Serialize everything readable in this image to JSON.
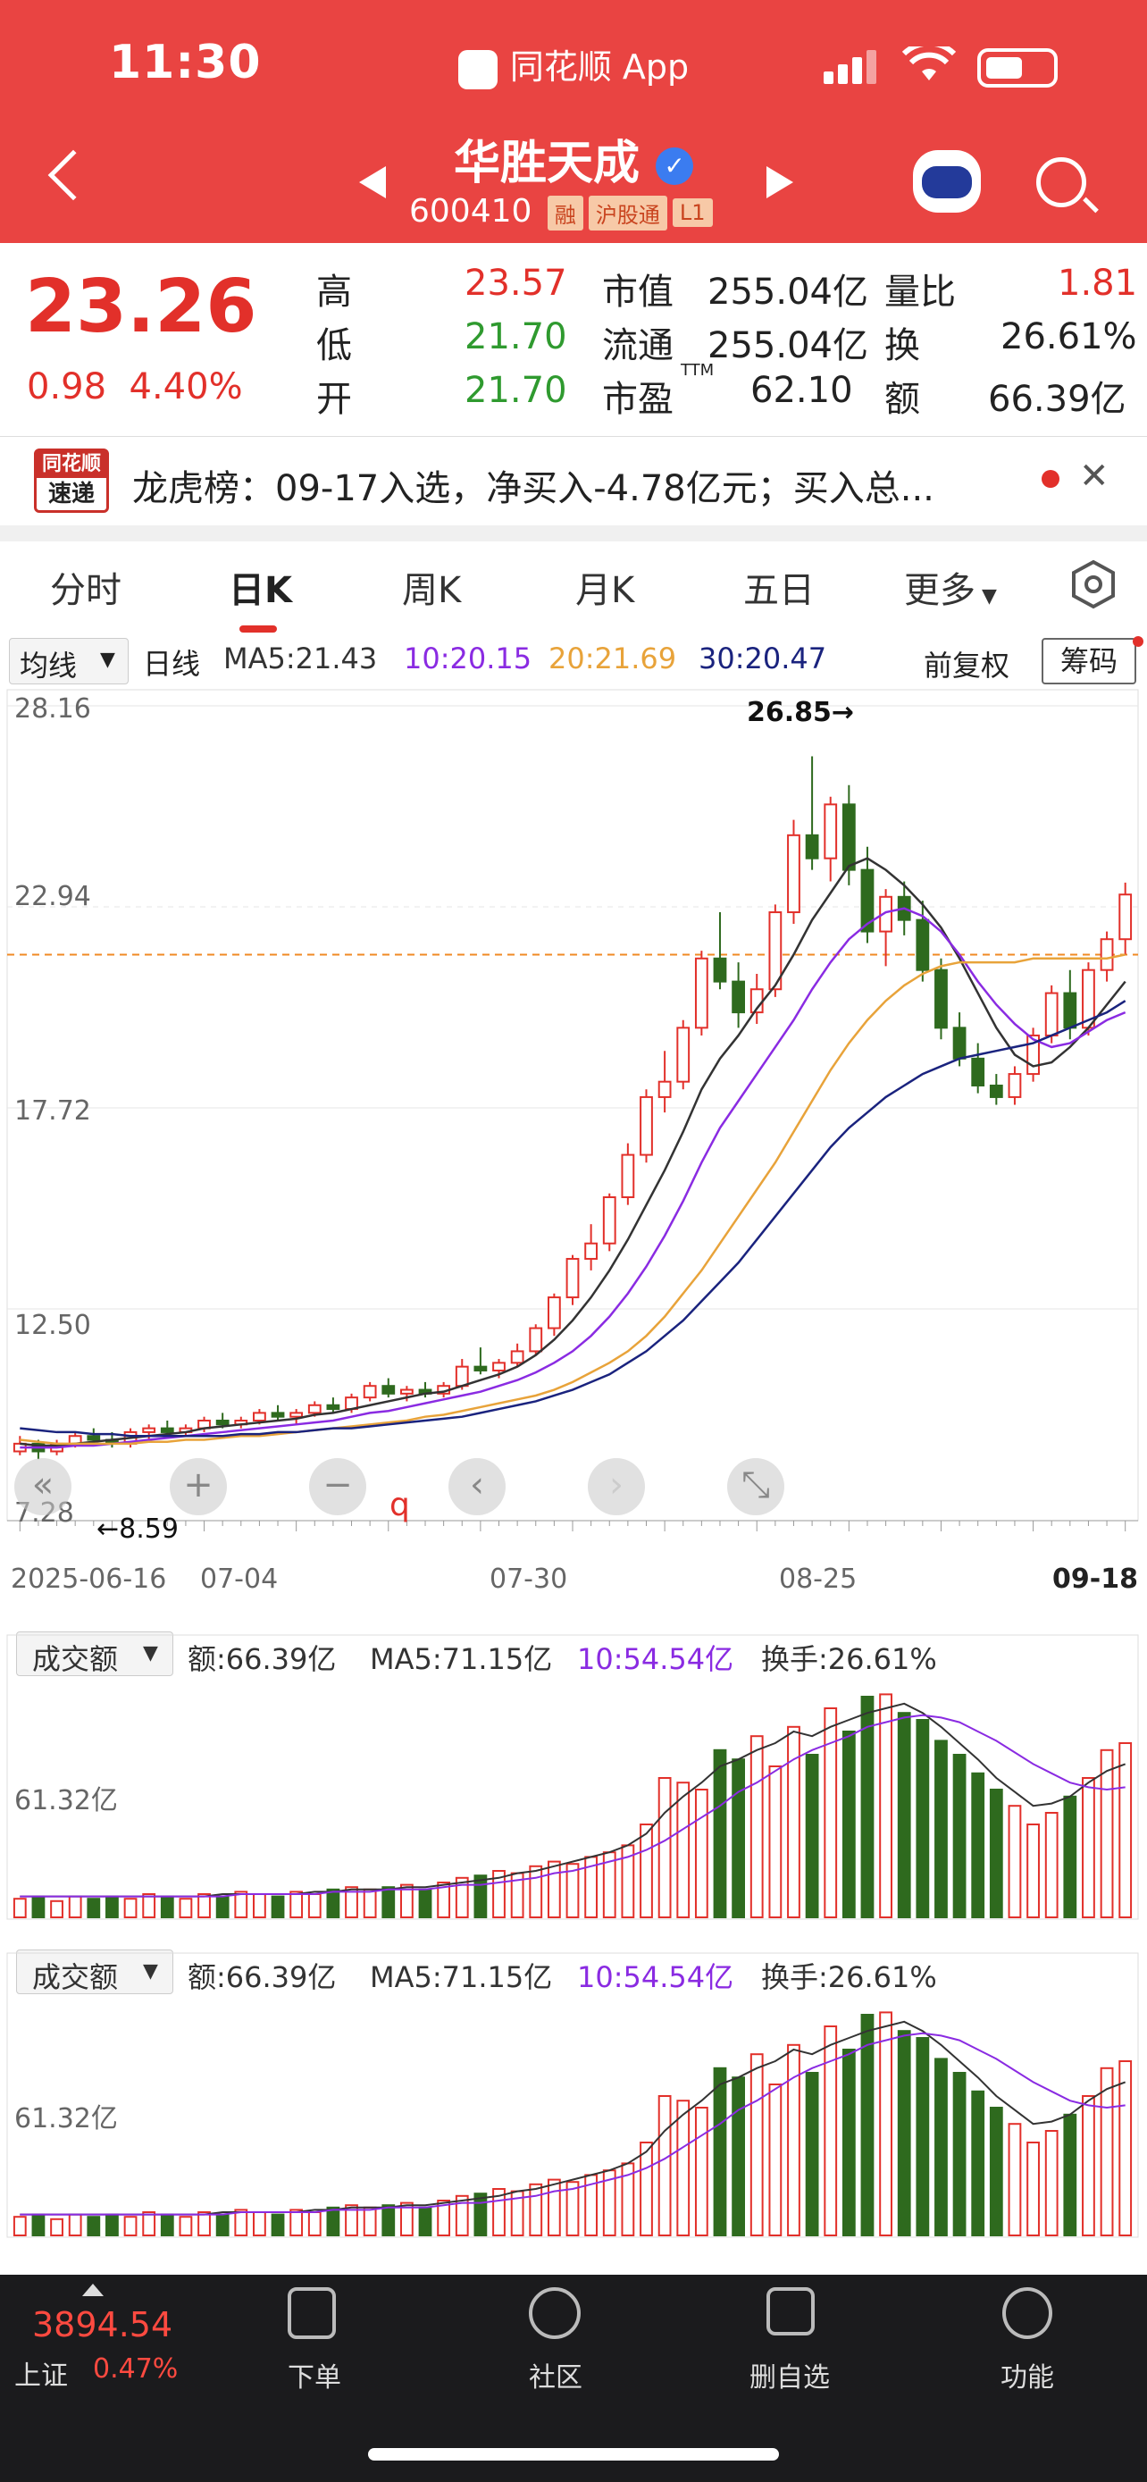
{
  "status_bar": {
    "time": "11:30",
    "app": "同花顺 App"
  },
  "header": {
    "stock_name": "华胜天成",
    "verified": "✓",
    "code": "600410",
    "tags": [
      "融",
      "沪股通",
      "L1"
    ]
  },
  "quote": {
    "price": "23.26",
    "change": "0.98",
    "change_pct": "4.40%",
    "fields": [
      {
        "label": "高",
        "value": "23.57"
      },
      {
        "label": "低",
        "value": "21.70"
      },
      {
        "label": "开",
        "value": "21.70"
      },
      {
        "label": "市值",
        "value": "255.04亿"
      },
      {
        "label": "流通",
        "value": "255.04亿"
      },
      {
        "label": "市盈",
        "sup": "TTM",
        "value": "62.10"
      },
      {
        "label": "量比",
        "value": "1.81"
      },
      {
        "label": "换",
        "value": "26.61%"
      },
      {
        "label": "额",
        "value": "66.39亿"
      }
    ]
  },
  "news": {
    "logo_top": "同花顺",
    "logo_bottom": "速递",
    "text": "龙虎榜：09-17入选，净买入-4.78亿元；买入总..."
  },
  "tabs": [
    "分时",
    "日K",
    "周K",
    "月K",
    "五日",
    "更多"
  ],
  "ma_row": {
    "selector": "均线",
    "period": "日线",
    "ma5": "MA5:21.43",
    "ma10": "10:20.15",
    "ma20": "20:21.69",
    "ma30": "30:20.47",
    "adjust": "前复权",
    "chips": "筹码"
  },
  "colors": {
    "up": "#e2302a",
    "down": "#2e6a1e",
    "ma5": "#333333",
    "ma10": "#8a2be2",
    "ma20": "#e8a33a",
    "ma30": "#1a237e",
    "header": "#e94442"
  },
  "chart_data": {
    "type": "candlestick",
    "y_ticks": [
      "28.16",
      "22.94",
      "17.72",
      "12.50",
      "7.28"
    ],
    "ylim": [
      7.28,
      28.16
    ],
    "x_ticks": [
      "2025-06-16",
      "07-04",
      "07-30",
      "08-25",
      "09-18"
    ],
    "annotations": {
      "high": "26.85→",
      "low": "←8.59",
      "marker": "q"
    },
    "current_price_line": 21.7,
    "candles": [
      [
        8.8,
        9.2,
        8.7,
        9.0
      ],
      [
        9.0,
        9.1,
        8.6,
        8.8
      ],
      [
        8.8,
        9.1,
        8.7,
        9.0
      ],
      [
        9.0,
        9.3,
        8.9,
        9.2
      ],
      [
        9.2,
        9.4,
        9.0,
        9.1
      ],
      [
        9.1,
        9.3,
        8.9,
        9.0
      ],
      [
        9.0,
        9.4,
        8.9,
        9.3
      ],
      [
        9.3,
        9.5,
        9.1,
        9.4
      ],
      [
        9.4,
        9.6,
        9.2,
        9.3
      ],
      [
        9.3,
        9.5,
        9.2,
        9.4
      ],
      [
        9.4,
        9.7,
        9.3,
        9.6
      ],
      [
        9.6,
        9.8,
        9.4,
        9.5
      ],
      [
        9.5,
        9.7,
        9.4,
        9.6
      ],
      [
        9.6,
        9.9,
        9.5,
        9.8
      ],
      [
        9.8,
        10.0,
        9.6,
        9.7
      ],
      [
        9.7,
        9.9,
        9.5,
        9.8
      ],
      [
        9.8,
        10.1,
        9.7,
        10.0
      ],
      [
        10.0,
        10.2,
        9.8,
        9.9
      ],
      [
        9.9,
        10.3,
        9.8,
        10.2
      ],
      [
        10.2,
        10.6,
        10.1,
        10.5
      ],
      [
        10.5,
        10.7,
        10.2,
        10.3
      ],
      [
        10.3,
        10.5,
        10.1,
        10.4
      ],
      [
        10.4,
        10.6,
        10.2,
        10.3
      ],
      [
        10.3,
        10.6,
        10.2,
        10.5
      ],
      [
        10.5,
        11.2,
        10.4,
        11.0
      ],
      [
        11.0,
        11.5,
        10.8,
        10.9
      ],
      [
        10.9,
        11.2,
        10.7,
        11.1
      ],
      [
        11.1,
        11.6,
        11.0,
        11.4
      ],
      [
        11.4,
        12.1,
        11.3,
        12.0
      ],
      [
        12.0,
        12.9,
        11.8,
        12.8
      ],
      [
        12.8,
        13.9,
        12.6,
        13.8
      ],
      [
        13.8,
        14.7,
        13.5,
        14.2
      ],
      [
        14.2,
        15.5,
        14.0,
        15.4
      ],
      [
        15.4,
        16.8,
        15.2,
        16.5
      ],
      [
        16.5,
        18.2,
        16.3,
        18.0
      ],
      [
        18.0,
        19.2,
        17.6,
        18.4
      ],
      [
        18.4,
        20.0,
        18.2,
        19.8
      ],
      [
        19.8,
        21.8,
        19.6,
        21.6
      ],
      [
        21.6,
        22.8,
        20.8,
        21.0
      ],
      [
        21.0,
        21.5,
        19.8,
        20.2
      ],
      [
        20.2,
        21.2,
        19.9,
        20.8
      ],
      [
        20.8,
        23.0,
        20.6,
        22.8
      ],
      [
        22.8,
        25.2,
        22.5,
        24.8
      ],
      [
        24.8,
        26.85,
        23.9,
        24.2
      ],
      [
        24.2,
        25.8,
        23.6,
        25.6
      ],
      [
        25.6,
        26.1,
        23.5,
        23.9
      ],
      [
        23.9,
        24.5,
        22.0,
        22.3
      ],
      [
        22.3,
        23.4,
        21.4,
        23.2
      ],
      [
        23.2,
        23.6,
        22.2,
        22.6
      ],
      [
        22.6,
        23.1,
        21.0,
        21.3
      ],
      [
        21.3,
        21.6,
        19.5,
        19.8
      ],
      [
        19.8,
        20.2,
        18.8,
        19.0
      ],
      [
        19.0,
        19.4,
        18.1,
        18.3
      ],
      [
        18.3,
        18.6,
        17.8,
        18.0
      ],
      [
        18.0,
        18.8,
        17.8,
        18.6
      ],
      [
        18.6,
        19.8,
        18.4,
        19.6
      ],
      [
        19.6,
        20.9,
        19.4,
        20.7
      ],
      [
        20.7,
        21.3,
        19.5,
        19.8
      ],
      [
        19.8,
        21.5,
        19.6,
        21.3
      ],
      [
        21.3,
        22.3,
        21.0,
        22.1
      ],
      [
        22.1,
        23.57,
        21.7,
        23.26
      ]
    ],
    "ma_lines": {
      "ma5": [
        9.0,
        8.95,
        8.95,
        9.0,
        9.05,
        9.1,
        9.15,
        9.2,
        9.25,
        9.3,
        9.4,
        9.45,
        9.5,
        9.55,
        9.6,
        9.65,
        9.75,
        9.8,
        9.9,
        10.0,
        10.1,
        10.2,
        10.3,
        10.35,
        10.5,
        10.65,
        10.8,
        11.0,
        11.3,
        11.7,
        12.2,
        12.8,
        13.5,
        14.3,
        15.2,
        16.1,
        17.1,
        18.2,
        19.0,
        19.6,
        20.3,
        20.9,
        21.7,
        22.6,
        23.3,
        24.0,
        24.2,
        23.9,
        23.5,
        23.0,
        22.4,
        21.6,
        20.7,
        19.8,
        19.1,
        18.8,
        18.9,
        19.3,
        19.8,
        20.4,
        21.0
      ],
      "ma10": [
        8.9,
        8.9,
        8.9,
        8.95,
        8.95,
        9.0,
        9.05,
        9.1,
        9.15,
        9.2,
        9.25,
        9.3,
        9.35,
        9.4,
        9.45,
        9.5,
        9.55,
        9.6,
        9.7,
        9.8,
        9.85,
        9.95,
        10.05,
        10.15,
        10.25,
        10.35,
        10.5,
        10.65,
        10.85,
        11.1,
        11.4,
        11.8,
        12.3,
        12.9,
        13.6,
        14.4,
        15.3,
        16.3,
        17.2,
        17.9,
        18.6,
        19.3,
        20.0,
        20.8,
        21.5,
        22.1,
        22.5,
        22.8,
        22.9,
        22.7,
        22.3,
        21.7,
        21.0,
        20.4,
        19.9,
        19.5,
        19.3,
        19.4,
        19.7,
        20.0,
        20.2
      ],
      "ma20": [
        9.1,
        9.05,
        9.0,
        9.0,
        9.0,
        9.0,
        9.0,
        9.05,
        9.05,
        9.1,
        9.1,
        9.15,
        9.2,
        9.2,
        9.25,
        9.3,
        9.35,
        9.4,
        9.45,
        9.5,
        9.55,
        9.6,
        9.7,
        9.75,
        9.85,
        9.95,
        10.05,
        10.15,
        10.25,
        10.4,
        10.6,
        10.85,
        11.1,
        11.4,
        11.8,
        12.3,
        12.9,
        13.5,
        14.2,
        14.9,
        15.6,
        16.3,
        17.1,
        17.9,
        18.7,
        19.4,
        20.0,
        20.5,
        20.9,
        21.2,
        21.4,
        21.5,
        21.5,
        21.5,
        21.5,
        21.6,
        21.6,
        21.6,
        21.6,
        21.6,
        21.7
      ],
      "ma30": [
        9.4,
        9.35,
        9.3,
        9.3,
        9.25,
        9.25,
        9.2,
        9.2,
        9.2,
        9.2,
        9.2,
        9.2,
        9.25,
        9.25,
        9.3,
        9.3,
        9.35,
        9.4,
        9.4,
        9.45,
        9.5,
        9.55,
        9.6,
        9.65,
        9.7,
        9.8,
        9.9,
        10.0,
        10.1,
        10.25,
        10.4,
        10.6,
        10.8,
        11.1,
        11.4,
        11.8,
        12.2,
        12.7,
        13.2,
        13.7,
        14.3,
        14.9,
        15.5,
        16.1,
        16.7,
        17.2,
        17.6,
        18.0,
        18.3,
        18.6,
        18.8,
        19.0,
        19.1,
        19.2,
        19.3,
        19.4,
        19.6,
        19.8,
        20.0,
        20.2,
        20.5
      ]
    }
  },
  "chart_controls": [
    "«",
    "+",
    "−",
    "‹",
    "›",
    "⤡"
  ],
  "volume_panels": [
    {
      "selector": "成交额",
      "amount": "额:66.39亿",
      "ma5": "MA5:71.15亿",
      "ma10": "10:54.54亿",
      "turnover": "换手:26.61%",
      "y_tick": "61.32亿"
    },
    {
      "selector": "成交额",
      "amount": "额:66.39亿",
      "ma5": "MA5:71.15亿",
      "ma10": "10:54.54亿",
      "turnover": "换手:26.61%",
      "y_tick": "61.32亿"
    }
  ],
  "volume_data": [
    8,
    9,
    7,
    9,
    8,
    9,
    8,
    10,
    9,
    8,
    10,
    9,
    11,
    10,
    9,
    11,
    10,
    12,
    13,
    12,
    13,
    14,
    12,
    15,
    17,
    18,
    20,
    19,
    22,
    24,
    23,
    26,
    28,
    31,
    40,
    60,
    58,
    55,
    72,
    68,
    78,
    65,
    82,
    70,
    90,
    80,
    95,
    96,
    88,
    85,
    76,
    70,
    62,
    55,
    48,
    40,
    45,
    52,
    60,
    72,
    75
  ],
  "volume_ma5": [
    9,
    9,
    9,
    9,
    9,
    9,
    9,
    9,
    9,
    9,
    9,
    10,
    10,
    10,
    10,
    10,
    11,
    11,
    12,
    12,
    12,
    13,
    13,
    14,
    15,
    16,
    17,
    19,
    20,
    22,
    24,
    26,
    28,
    31,
    36,
    45,
    52,
    58,
    65,
    68,
    72,
    75,
    80,
    78,
    82,
    85,
    88,
    90,
    92,
    88,
    82,
    75,
    68,
    60,
    54,
    48,
    49,
    52,
    58,
    63,
    66
  ],
  "volume_ma10": [
    9,
    9,
    9,
    9,
    9,
    9,
    9,
    9,
    9,
    9,
    9,
    9,
    10,
    10,
    10,
    10,
    10,
    11,
    11,
    11,
    12,
    12,
    12,
    13,
    14,
    14,
    15,
    16,
    17,
    19,
    20,
    22,
    24,
    26,
    29,
    33,
    38,
    43,
    48,
    54,
    58,
    63,
    68,
    72,
    75,
    78,
    82,
    84,
    86,
    87,
    86,
    84,
    80,
    76,
    71,
    66,
    62,
    58,
    56,
    55,
    56
  ],
  "bottom_bar": {
    "index_value": "3894.54",
    "index_name": "上证",
    "index_change": "0.47%",
    "items": [
      "下单",
      "社区",
      "删自选",
      "功能"
    ]
  }
}
